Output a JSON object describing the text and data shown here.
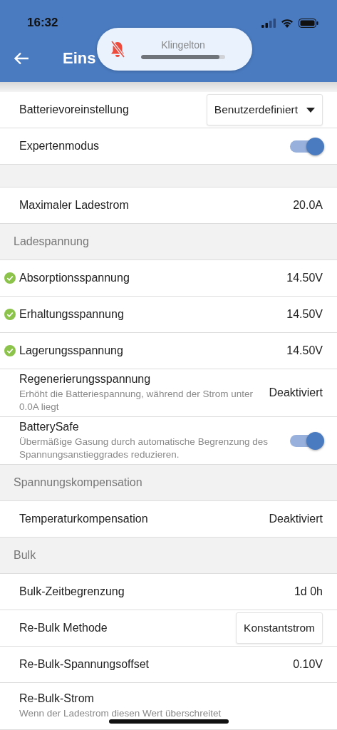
{
  "status_bar": {
    "time": "16:32"
  },
  "app_bar": {
    "title": "Eins"
  },
  "volume_hud": {
    "label": "Klingelton",
    "muted": true,
    "level": 0.93
  },
  "rows": [
    {
      "kind": "select",
      "label": "Batterievoreinstellung",
      "value": "Benutzerdefiniert"
    },
    {
      "kind": "toggle",
      "label": "Expertenmodus",
      "on": true
    },
    {
      "kind": "gap"
    },
    {
      "kind": "value",
      "label": "Maximaler Ladestrom",
      "value": "20.0A",
      "verified": false
    },
    {
      "kind": "header",
      "label": "Ladespannung"
    },
    {
      "kind": "value",
      "label": "Absorptionsspannung",
      "value": "14.50V",
      "verified": true
    },
    {
      "kind": "value",
      "label": "Erhaltungsspannung",
      "value": "14.50V",
      "verified": true
    },
    {
      "kind": "value",
      "label": "Lagerungsspannung",
      "value": "14.50V",
      "verified": true
    },
    {
      "kind": "value",
      "label": "Regenerierungsspannung",
      "subtitle": "Erhöht die Batteriespannung, während der Strom unter 0.0A liegt",
      "value": "Deaktiviert",
      "verified": false
    },
    {
      "kind": "toggle",
      "label": "BatterySafe",
      "subtitle": "Übermäßige Gasung durch automatische Begrenzung des Spannungsanstieggrades reduzieren.",
      "on": true
    },
    {
      "kind": "header",
      "label": "Spannungskompensation"
    },
    {
      "kind": "value",
      "label": "Temperaturkompensation",
      "value": "Deaktiviert",
      "verified": false
    },
    {
      "kind": "header",
      "label": "Bulk"
    },
    {
      "kind": "value",
      "label": "Bulk-Zeitbegrenzung",
      "value": "1d 0h",
      "verified": false
    },
    {
      "kind": "button",
      "label": "Re-Bulk Methode",
      "value": "Konstantstrom"
    },
    {
      "kind": "value",
      "label": "Re-Bulk-Spannungsoffset",
      "value": "0.10V",
      "verified": false
    },
    {
      "kind": "value",
      "label": "Re-Bulk-Strom",
      "subtitle": "Wenn der Ladestrom diesen Wert überschreitet",
      "verified": false
    }
  ]
}
